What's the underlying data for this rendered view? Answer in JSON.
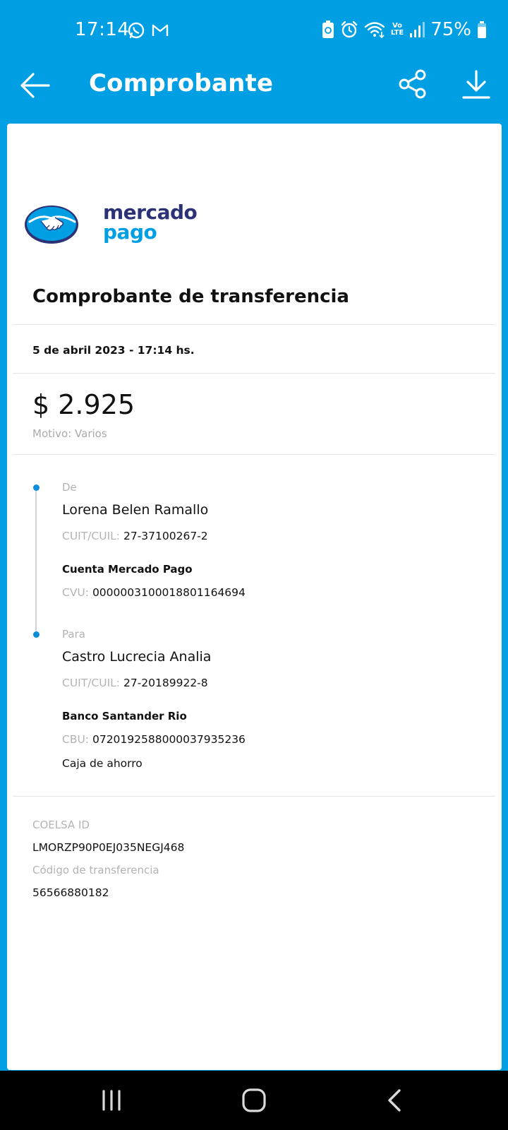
{
  "status_bar": {
    "time": "17:14",
    "battery": "75%",
    "left_icons": [
      "whatsapp-icon",
      "gmail-icon"
    ],
    "right_icons": [
      "battery-saver-icon",
      "alarm-icon",
      "wifi-icon",
      "volte-icon",
      "signal-icon",
      "battery-icon"
    ],
    "volte": {
      "top": "Vo",
      "bottom": "LTE"
    }
  },
  "app_bar": {
    "title": "Comprobante",
    "background": "#009ee3"
  },
  "receipt": {
    "logo": {
      "line1": "mercado",
      "line2": "pago"
    },
    "title": "Comprobante de transferencia",
    "date": "5 de abril 2023 - 17:14 hs.",
    "amount": "$ 2.925",
    "reason": "Motivo: Varios",
    "from": {
      "label": "De",
      "name": "Lorena Belen Ramallo",
      "cuit_key": "CUIT/CUIL:",
      "cuit_value": "27-37100267-2",
      "bank": "Cuenta Mercado Pago",
      "account_key": "CVU:",
      "account_value": "0000003100018801164694"
    },
    "to": {
      "label": "Para",
      "name": "Castro Lucrecia Analia",
      "cuit_key": "CUIT/CUIL:",
      "cuit_value": "27-20189922-8",
      "bank": "Banco Santander Rio",
      "account_key": "CBU:",
      "account_value": "0720192588000037935236",
      "account_type": "Caja de ahorro"
    },
    "coelsa_label": "COELSA ID",
    "coelsa_value": "LMORZP90P0EJ035NEGJ468",
    "code_label": "Código de transferencia",
    "code_value": "56566880182"
  },
  "colors": {
    "brand_blue": "#009ee3",
    "brand_navy": "#2d3277",
    "timeline_dot": "#0a8ddb"
  }
}
